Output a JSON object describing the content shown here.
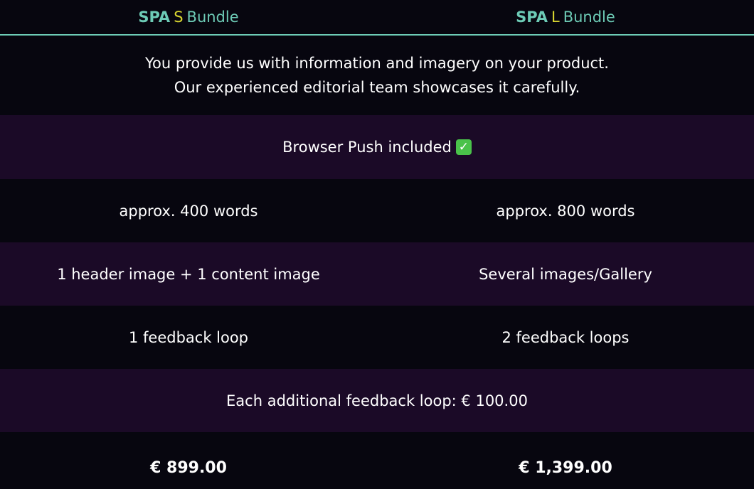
{
  "header": {
    "left": {
      "spa": "SPA",
      "size": "S",
      "bundle": "Bundle"
    },
    "right": {
      "spa": "SPA",
      "size": "L",
      "bundle": "Bundle"
    }
  },
  "description": {
    "line1": "You provide us with information and imagery on your product.",
    "line2": "Our experienced editorial team showcases it carefully."
  },
  "push": {
    "label": "Browser Push included",
    "icon": "check-box-icon",
    "icon_glyph": "✓"
  },
  "rows": {
    "words": {
      "left": "approx. 400 words",
      "right": "approx. 800 words"
    },
    "images": {
      "left": "1 header image + 1 content image",
      "right": "Several images/Gallery"
    },
    "feedback": {
      "left": "1 feedback loop",
      "right": "2 feedback loops"
    }
  },
  "additional": "Each additional feedback loop: € 100.00",
  "prices": {
    "left": "€ 899.00",
    "right": "€ 1,399.00"
  },
  "colors": {
    "accent_teal": "#6dcbb6",
    "accent_yellow": "#d9d630",
    "row_purple": "#1b0a27",
    "background": "#07060f",
    "check_green": "#4ac24a"
  }
}
